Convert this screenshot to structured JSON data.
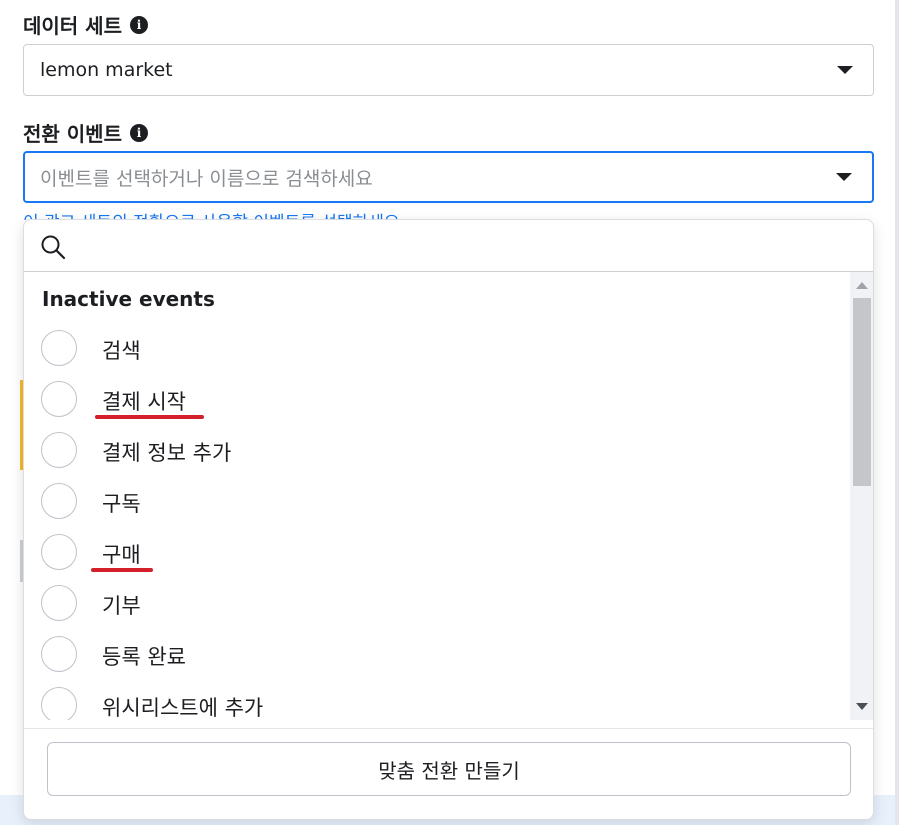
{
  "dataset": {
    "label": "데이터 세트",
    "value": "lemon market"
  },
  "conversion_event": {
    "label": "전환 이벤트",
    "placeholder": "이벤트를 선택하거나 이름으로 검색하세요",
    "helper_text": "이 광고 세트의 전환으로 사용할 이벤트를 선택하세요."
  },
  "dropdown": {
    "search_value": "",
    "section_title": "Inactive events",
    "items": [
      {
        "label": "검색",
        "selected": false
      },
      {
        "label": "결제 시작",
        "selected": false
      },
      {
        "label": "결제 정보 추가",
        "selected": false
      },
      {
        "label": "구독",
        "selected": false
      },
      {
        "label": "구매",
        "selected": false
      },
      {
        "label": "기부",
        "selected": false
      },
      {
        "label": "등록 완료",
        "selected": false
      },
      {
        "label": "위시리스트에 추가",
        "selected": false
      }
    ],
    "create_button_label": "맞춤 전환 만들기"
  },
  "colors": {
    "accent": "#1877f2",
    "annotation_underline": "#d4202a",
    "text": "#1c1e21"
  },
  "icons": [
    "info-icon",
    "caret-down-icon",
    "search-icon",
    "radio-icon",
    "scroll-up-icon",
    "scroll-down-icon"
  ]
}
